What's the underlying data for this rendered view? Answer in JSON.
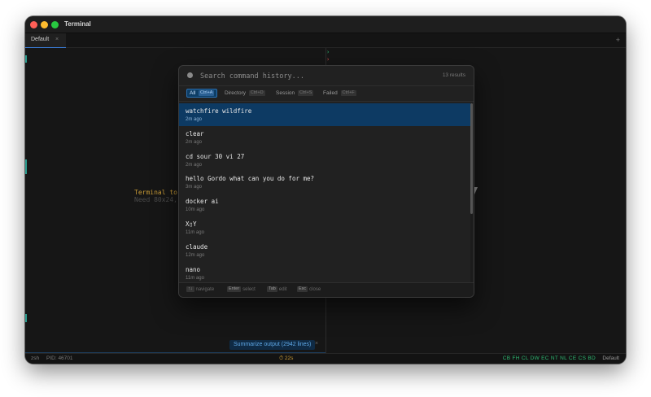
{
  "window": {
    "title": "Terminal"
  },
  "tabs": [
    {
      "label": "Default",
      "close": "×"
    }
  ],
  "tab_add": "+",
  "left_pane": {
    "placeholder_line1": "Terminal to",
    "placeholder_line2": "Need 80x24, g"
  },
  "right_pane": {
    "prompt_ok": "›",
    "prompt_err": "›"
  },
  "summarize": {
    "label": "Summarize output (2942 lines)",
    "close": "×"
  },
  "statusbar": {
    "shell": "zsh",
    "pid": "PID: 46701",
    "timer": "⏱ 22s",
    "flags": "CB FH CL DW EC NT NL CE CS BD",
    "profile": "Default"
  },
  "history": {
    "search_placeholder": "Search command history...",
    "results_count": "13 results",
    "filters": [
      {
        "label": "All",
        "shortcut": "Ctrl+A",
        "active": true
      },
      {
        "label": "Directory",
        "shortcut": "Ctrl+D",
        "active": false
      },
      {
        "label": "Session",
        "shortcut": "Ctrl+S",
        "active": false
      },
      {
        "label": "Failed",
        "shortcut": "Ctrl+F",
        "active": false
      }
    ],
    "items": [
      {
        "command": "watchfire wildfire",
        "time": "2m ago"
      },
      {
        "command": "clear",
        "time": "2m ago"
      },
      {
        "command": "cd sour 30 vi 27",
        "time": "2m ago"
      },
      {
        "command": "hello Gordo what can you do for me?",
        "time": "3m ago"
      },
      {
        "command": "docker ai",
        "time": "10m ago"
      },
      {
        "command": "X▯Y",
        "time": "11m ago"
      },
      {
        "command": "claude",
        "time": "12m ago"
      },
      {
        "command": "nano",
        "time": "11m ago"
      }
    ],
    "footer_hints": [
      {
        "key": "↑↓",
        "action": "navigate"
      },
      {
        "key": "Enter",
        "action": "select"
      },
      {
        "key": "Tab",
        "action": "edit"
      },
      {
        "key": "Esc",
        "action": "close"
      }
    ]
  },
  "colors": {
    "accent": "#3a7bd5",
    "selected_row": "#0d3a63",
    "timer": "#c79a36",
    "status_green": "#2eb872"
  }
}
